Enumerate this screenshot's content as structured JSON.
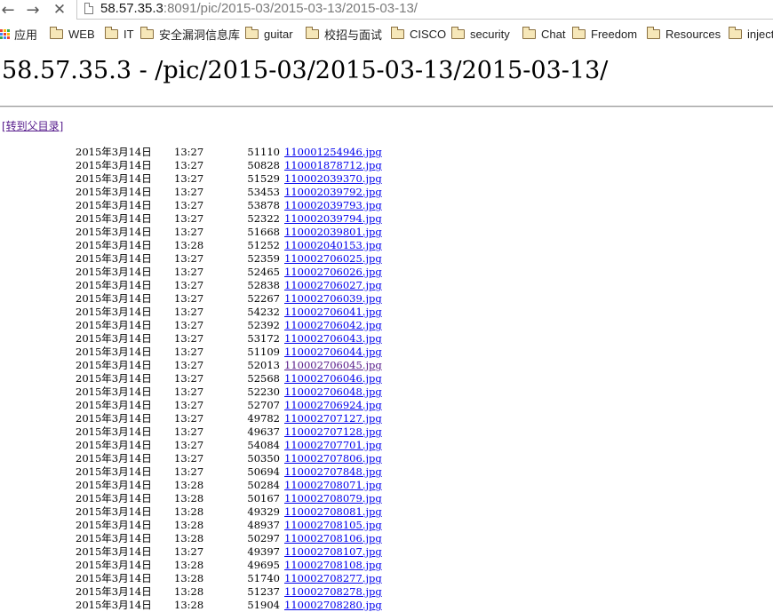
{
  "browser": {
    "url_host": "58.57.35.3",
    "url_rest": ":8091/pic/2015-03/2015-03-13/2015-03-13/",
    "back_glyph": "←",
    "forward_glyph": "→",
    "stop_glyph": "✕"
  },
  "bookmarks": [
    {
      "label": "应用",
      "icon": "apps-icon"
    },
    {
      "label": "WEB",
      "icon": "folder-icon"
    },
    {
      "label": "IT",
      "icon": "folder-icon"
    },
    {
      "label": "安全漏洞信息库",
      "icon": "folder-icon"
    },
    {
      "label": "guitar",
      "icon": "folder-icon"
    },
    {
      "label": "校招与面试",
      "icon": "folder-icon"
    },
    {
      "label": "CISCO",
      "icon": "folder-icon"
    },
    {
      "label": "security",
      "icon": "folder-icon"
    },
    {
      "label": "Chat",
      "icon": "folder-icon"
    },
    {
      "label": "Freedom",
      "icon": "folder-icon"
    },
    {
      "label": "Resources",
      "icon": "folder-icon"
    },
    {
      "label": "inject",
      "icon": "folder-icon"
    }
  ],
  "page": {
    "title": "58.57.35.3 - /pic/2015-03/2015-03-13/2015-03-13/",
    "parent_link": "[转到父目录]"
  },
  "listing": [
    {
      "date": "2015年3月14日",
      "time": "13:27",
      "size": "51110",
      "name": "110001254946.jpg"
    },
    {
      "date": "2015年3月14日",
      "time": "13:27",
      "size": "50828",
      "name": "110001878712.jpg"
    },
    {
      "date": "2015年3月14日",
      "time": "13:27",
      "size": "51529",
      "name": "110002039370.jpg"
    },
    {
      "date": "2015年3月14日",
      "time": "13:27",
      "size": "53453",
      "name": "110002039792.jpg"
    },
    {
      "date": "2015年3月14日",
      "time": "13:27",
      "size": "53878",
      "name": "110002039793.jpg"
    },
    {
      "date": "2015年3月14日",
      "time": "13:27",
      "size": "52322",
      "name": "110002039794.jpg"
    },
    {
      "date": "2015年3月14日",
      "time": "13:27",
      "size": "51668",
      "name": "110002039801.jpg"
    },
    {
      "date": "2015年3月14日",
      "time": "13:28",
      "size": "51252",
      "name": "110002040153.jpg"
    },
    {
      "date": "2015年3月14日",
      "time": "13:27",
      "size": "52359",
      "name": "110002706025.jpg"
    },
    {
      "date": "2015年3月14日",
      "time": "13:27",
      "size": "52465",
      "name": "110002706026.jpg"
    },
    {
      "date": "2015年3月14日",
      "time": "13:27",
      "size": "52838",
      "name": "110002706027.jpg"
    },
    {
      "date": "2015年3月14日",
      "time": "13:27",
      "size": "52267",
      "name": "110002706039.jpg"
    },
    {
      "date": "2015年3月14日",
      "time": "13:27",
      "size": "54232",
      "name": "110002706041.jpg"
    },
    {
      "date": "2015年3月14日",
      "time": "13:27",
      "size": "52392",
      "name": "110002706042.jpg"
    },
    {
      "date": "2015年3月14日",
      "time": "13:27",
      "size": "53172",
      "name": "110002706043.jpg"
    },
    {
      "date": "2015年3月14日",
      "time": "13:27",
      "size": "51109",
      "name": "110002706044.jpg"
    },
    {
      "date": "2015年3月14日",
      "time": "13:27",
      "size": "52013",
      "name": "110002706045.jpg",
      "visited": true
    },
    {
      "date": "2015年3月14日",
      "time": "13:27",
      "size": "52568",
      "name": "110002706046.jpg"
    },
    {
      "date": "2015年3月14日",
      "time": "13:27",
      "size": "52230",
      "name": "110002706048.jpg"
    },
    {
      "date": "2015年3月14日",
      "time": "13:27",
      "size": "52707",
      "name": "110002706924.jpg"
    },
    {
      "date": "2015年3月14日",
      "time": "13:27",
      "size": "49782",
      "name": "110002707127.jpg"
    },
    {
      "date": "2015年3月14日",
      "time": "13:27",
      "size": "49637",
      "name": "110002707128.jpg"
    },
    {
      "date": "2015年3月14日",
      "time": "13:27",
      "size": "54084",
      "name": "110002707701.jpg"
    },
    {
      "date": "2015年3月14日",
      "time": "13:27",
      "size": "50350",
      "name": "110002707806.jpg"
    },
    {
      "date": "2015年3月14日",
      "time": "13:27",
      "size": "50694",
      "name": "110002707848.jpg"
    },
    {
      "date": "2015年3月14日",
      "time": "13:28",
      "size": "50284",
      "name": "110002708071.jpg"
    },
    {
      "date": "2015年3月14日",
      "time": "13:28",
      "size": "50167",
      "name": "110002708079.jpg"
    },
    {
      "date": "2015年3月14日",
      "time": "13:28",
      "size": "49329",
      "name": "110002708081.jpg"
    },
    {
      "date": "2015年3月14日",
      "time": "13:28",
      "size": "48937",
      "name": "110002708105.jpg"
    },
    {
      "date": "2015年3月14日",
      "time": "13:28",
      "size": "50297",
      "name": "110002708106.jpg"
    },
    {
      "date": "2015年3月14日",
      "time": "13:27",
      "size": "49397",
      "name": "110002708107.jpg"
    },
    {
      "date": "2015年3月14日",
      "time": "13:28",
      "size": "49695",
      "name": "110002708108.jpg"
    },
    {
      "date": "2015年3月14日",
      "time": "13:28",
      "size": "51740",
      "name": "110002708277.jpg"
    },
    {
      "date": "2015年3月14日",
      "time": "13:28",
      "size": "51237",
      "name": "110002708278.jpg"
    },
    {
      "date": "2015年3月14日",
      "time": "13:28",
      "size": "51904",
      "name": "110002708280.jpg"
    }
  ],
  "colors": {
    "link": "#0000ee",
    "visited_link": "#551a8b",
    "apps_grid": [
      "#e94235",
      "#fbbc04",
      "#34a853",
      "#4285f4",
      "#e94235",
      "#fbbc04",
      "#34a853",
      "#4285f4",
      "#e94235"
    ]
  }
}
